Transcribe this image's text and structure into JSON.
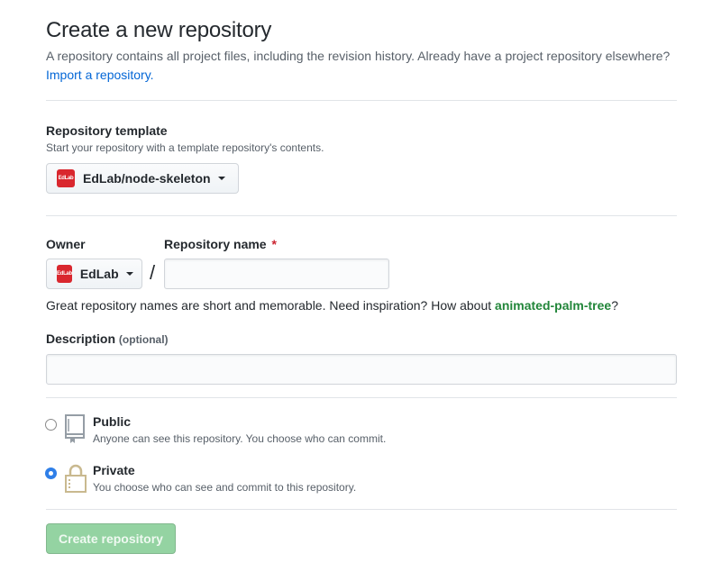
{
  "header": {
    "title": "Create a new repository",
    "subtitle": "A repository contains all project files, including the revision history. Already have a project repository elsewhere?",
    "import_link": "Import a repository."
  },
  "template": {
    "label": "Repository template",
    "note": "Start your repository with a template repository's contents.",
    "selected": "EdLab/node-skeleton",
    "logo_text": "EdLab"
  },
  "owner": {
    "label": "Owner",
    "selected": "EdLab",
    "logo_text": "EdLab"
  },
  "repo_name": {
    "label": "Repository name",
    "required_mark": "*",
    "value": "",
    "separator": "/"
  },
  "inspiration": {
    "text": "Great repository names are short and memorable. Need inspiration? How about",
    "suggestion": "animated-palm-tree",
    "suffix": "?"
  },
  "description": {
    "label": "Description",
    "optional": "(optional)",
    "value": ""
  },
  "visibility": {
    "public": {
      "title": "Public",
      "desc": "Anyone can see this repository. You choose who can commit.",
      "checked": false,
      "icon": "repo-icon"
    },
    "private": {
      "title": "Private",
      "desc": "You choose who can see and commit to this repository.",
      "checked": true,
      "icon": "lock-icon"
    }
  },
  "submit": {
    "label": "Create repository",
    "disabled": true
  },
  "colors": {
    "link": "#0366d6",
    "suggestion": "#22863a",
    "required": "#cb2431",
    "primary_disabled": "#94d3a2",
    "radio_checked": "#2f7fe8",
    "brand": "#d9272e"
  }
}
